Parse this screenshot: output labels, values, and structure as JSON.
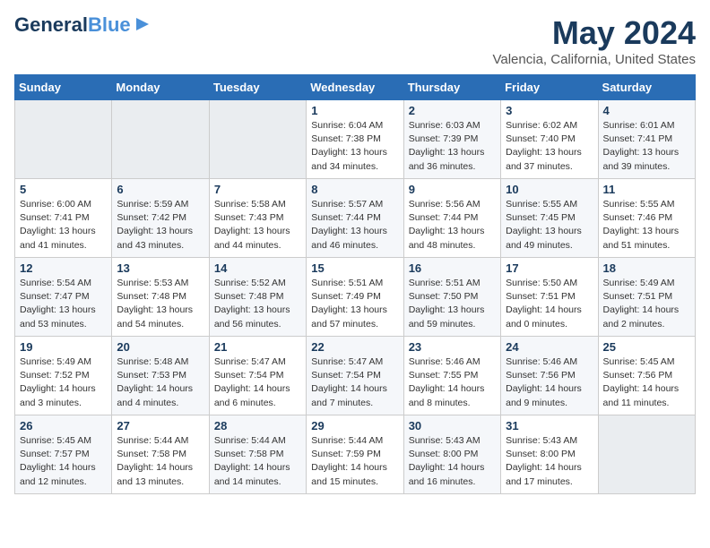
{
  "header": {
    "logo_line1": "General",
    "logo_line2": "Blue",
    "month_year": "May 2024",
    "location": "Valencia, California, United States"
  },
  "weekdays": [
    "Sunday",
    "Monday",
    "Tuesday",
    "Wednesday",
    "Thursday",
    "Friday",
    "Saturday"
  ],
  "weeks": [
    [
      {
        "day": "",
        "sunrise": "",
        "sunset": "",
        "daylight": ""
      },
      {
        "day": "",
        "sunrise": "",
        "sunset": "",
        "daylight": ""
      },
      {
        "day": "",
        "sunrise": "",
        "sunset": "",
        "daylight": ""
      },
      {
        "day": "1",
        "sunrise": "Sunrise: 6:04 AM",
        "sunset": "Sunset: 7:38 PM",
        "daylight": "Daylight: 13 hours and 34 minutes."
      },
      {
        "day": "2",
        "sunrise": "Sunrise: 6:03 AM",
        "sunset": "Sunset: 7:39 PM",
        "daylight": "Daylight: 13 hours and 36 minutes."
      },
      {
        "day": "3",
        "sunrise": "Sunrise: 6:02 AM",
        "sunset": "Sunset: 7:40 PM",
        "daylight": "Daylight: 13 hours and 37 minutes."
      },
      {
        "day": "4",
        "sunrise": "Sunrise: 6:01 AM",
        "sunset": "Sunset: 7:41 PM",
        "daylight": "Daylight: 13 hours and 39 minutes."
      }
    ],
    [
      {
        "day": "5",
        "sunrise": "Sunrise: 6:00 AM",
        "sunset": "Sunset: 7:41 PM",
        "daylight": "Daylight: 13 hours and 41 minutes."
      },
      {
        "day": "6",
        "sunrise": "Sunrise: 5:59 AM",
        "sunset": "Sunset: 7:42 PM",
        "daylight": "Daylight: 13 hours and 43 minutes."
      },
      {
        "day": "7",
        "sunrise": "Sunrise: 5:58 AM",
        "sunset": "Sunset: 7:43 PM",
        "daylight": "Daylight: 13 hours and 44 minutes."
      },
      {
        "day": "8",
        "sunrise": "Sunrise: 5:57 AM",
        "sunset": "Sunset: 7:44 PM",
        "daylight": "Daylight: 13 hours and 46 minutes."
      },
      {
        "day": "9",
        "sunrise": "Sunrise: 5:56 AM",
        "sunset": "Sunset: 7:44 PM",
        "daylight": "Daylight: 13 hours and 48 minutes."
      },
      {
        "day": "10",
        "sunrise": "Sunrise: 5:55 AM",
        "sunset": "Sunset: 7:45 PM",
        "daylight": "Daylight: 13 hours and 49 minutes."
      },
      {
        "day": "11",
        "sunrise": "Sunrise: 5:55 AM",
        "sunset": "Sunset: 7:46 PM",
        "daylight": "Daylight: 13 hours and 51 minutes."
      }
    ],
    [
      {
        "day": "12",
        "sunrise": "Sunrise: 5:54 AM",
        "sunset": "Sunset: 7:47 PM",
        "daylight": "Daylight: 13 hours and 53 minutes."
      },
      {
        "day": "13",
        "sunrise": "Sunrise: 5:53 AM",
        "sunset": "Sunset: 7:48 PM",
        "daylight": "Daylight: 13 hours and 54 minutes."
      },
      {
        "day": "14",
        "sunrise": "Sunrise: 5:52 AM",
        "sunset": "Sunset: 7:48 PM",
        "daylight": "Daylight: 13 hours and 56 minutes."
      },
      {
        "day": "15",
        "sunrise": "Sunrise: 5:51 AM",
        "sunset": "Sunset: 7:49 PM",
        "daylight": "Daylight: 13 hours and 57 minutes."
      },
      {
        "day": "16",
        "sunrise": "Sunrise: 5:51 AM",
        "sunset": "Sunset: 7:50 PM",
        "daylight": "Daylight: 13 hours and 59 minutes."
      },
      {
        "day": "17",
        "sunrise": "Sunrise: 5:50 AM",
        "sunset": "Sunset: 7:51 PM",
        "daylight": "Daylight: 14 hours and 0 minutes."
      },
      {
        "day": "18",
        "sunrise": "Sunrise: 5:49 AM",
        "sunset": "Sunset: 7:51 PM",
        "daylight": "Daylight: 14 hours and 2 minutes."
      }
    ],
    [
      {
        "day": "19",
        "sunrise": "Sunrise: 5:49 AM",
        "sunset": "Sunset: 7:52 PM",
        "daylight": "Daylight: 14 hours and 3 minutes."
      },
      {
        "day": "20",
        "sunrise": "Sunrise: 5:48 AM",
        "sunset": "Sunset: 7:53 PM",
        "daylight": "Daylight: 14 hours and 4 minutes."
      },
      {
        "day": "21",
        "sunrise": "Sunrise: 5:47 AM",
        "sunset": "Sunset: 7:54 PM",
        "daylight": "Daylight: 14 hours and 6 minutes."
      },
      {
        "day": "22",
        "sunrise": "Sunrise: 5:47 AM",
        "sunset": "Sunset: 7:54 PM",
        "daylight": "Daylight: 14 hours and 7 minutes."
      },
      {
        "day": "23",
        "sunrise": "Sunrise: 5:46 AM",
        "sunset": "Sunset: 7:55 PM",
        "daylight": "Daylight: 14 hours and 8 minutes."
      },
      {
        "day": "24",
        "sunrise": "Sunrise: 5:46 AM",
        "sunset": "Sunset: 7:56 PM",
        "daylight": "Daylight: 14 hours and 9 minutes."
      },
      {
        "day": "25",
        "sunrise": "Sunrise: 5:45 AM",
        "sunset": "Sunset: 7:56 PM",
        "daylight": "Daylight: 14 hours and 11 minutes."
      }
    ],
    [
      {
        "day": "26",
        "sunrise": "Sunrise: 5:45 AM",
        "sunset": "Sunset: 7:57 PM",
        "daylight": "Daylight: 14 hours and 12 minutes."
      },
      {
        "day": "27",
        "sunrise": "Sunrise: 5:44 AM",
        "sunset": "Sunset: 7:58 PM",
        "daylight": "Daylight: 14 hours and 13 minutes."
      },
      {
        "day": "28",
        "sunrise": "Sunrise: 5:44 AM",
        "sunset": "Sunset: 7:58 PM",
        "daylight": "Daylight: 14 hours and 14 minutes."
      },
      {
        "day": "29",
        "sunrise": "Sunrise: 5:44 AM",
        "sunset": "Sunset: 7:59 PM",
        "daylight": "Daylight: 14 hours and 15 minutes."
      },
      {
        "day": "30",
        "sunrise": "Sunrise: 5:43 AM",
        "sunset": "Sunset: 8:00 PM",
        "daylight": "Daylight: 14 hours and 16 minutes."
      },
      {
        "day": "31",
        "sunrise": "Sunrise: 5:43 AM",
        "sunset": "Sunset: 8:00 PM",
        "daylight": "Daylight: 14 hours and 17 minutes."
      },
      {
        "day": "",
        "sunrise": "",
        "sunset": "",
        "daylight": ""
      }
    ]
  ]
}
